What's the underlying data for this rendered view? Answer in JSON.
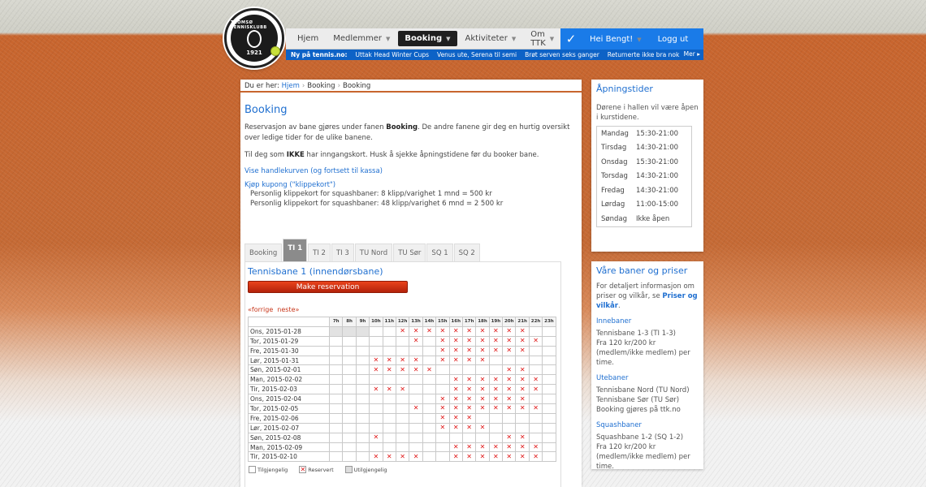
{
  "logo": {
    "name": "TROMSØ TENNISKLUBB",
    "year": "1921"
  },
  "nav": {
    "items": [
      {
        "label": "Hjem",
        "caret": false,
        "active": false
      },
      {
        "label": "Medlemmer",
        "caret": true,
        "active": false
      },
      {
        "label": "Booking",
        "caret": true,
        "active": true
      },
      {
        "label": "Aktiviteter",
        "caret": true,
        "active": false
      },
      {
        "label": "Om TTK",
        "caret": true,
        "active": false
      }
    ]
  },
  "user": {
    "greeting": "Hei Bengt!",
    "logout": "Logg ut",
    "check": "✓"
  },
  "ticker": {
    "label": "Ny på tennis.no:",
    "items": [
      "Uttak Head Winter Cups",
      "Venus ute, Serena til semi",
      "Brøt serven seks ganger",
      "Returnerte ikke bra nok"
    ],
    "more": "Mer ▸"
  },
  "breadcrumb": {
    "prefix": "Du er her:",
    "home": "Hjem",
    "level1": "Booking",
    "level2": "Booking"
  },
  "page": {
    "title": "Booking",
    "intro_pre": "Reservasjon av bane gjøres under fanen ",
    "intro_bold": "Booking",
    "intro_post": ". De andre fanene gir deg en hurtig oversikt over ledige tider for de ulike banene.",
    "card_pre": "Til deg som ",
    "card_bold": "IKKE",
    "card_post": " har inngangskort. Husk å sjekke åpningstidene før du booker bane.",
    "cart_link": "Vise handlekurven (og fortsett til kassa)",
    "coupon_link": "Kjøp kupong (\"klippekort\")",
    "coupon_1": "Personlig klippekort for squashbaner: 8 klipp/varighet 1 mnd = 500 kr",
    "coupon_2": "Personlig klippekort for squashbaner: 48 klipp/varighet 6 mnd = 2 500 kr"
  },
  "tabs": [
    "Booking",
    "TI 1",
    "TI 2",
    "TI 3",
    "TU Nord",
    "TU Sør",
    "SQ 1",
    "SQ 2"
  ],
  "active_tab": 1,
  "court": {
    "title": "Tennisbane 1 (innendørsbane)",
    "make_button": "Make reservation",
    "prev": "«forrige",
    "next": "neste»",
    "hours": [
      "7h",
      "8h",
      "9h",
      "10h",
      "11h",
      "12h",
      "13h",
      "14h",
      "15h",
      "16h",
      "17h",
      "18h",
      "19h",
      "20h",
      "21h",
      "22h",
      "23h"
    ],
    "rows": [
      {
        "date": "Ons, 2015-01-28",
        "cells": "UUU..XXXXXXXXXX.."
      },
      {
        "date": "Tor, 2015-01-29",
        "cells": "......X.XXXXXXXX."
      },
      {
        "date": "Fre, 2015-01-30",
        "cells": "........XXXXXXX.."
      },
      {
        "date": "Lør, 2015-01-31",
        "cells": "...XXXX.XXXX....."
      },
      {
        "date": "Søn, 2015-02-01",
        "cells": "...XXXXX.....XX.."
      },
      {
        "date": "Man, 2015-02-02",
        "cells": ".........XXXXXXX."
      },
      {
        "date": "Tir, 2015-02-03",
        "cells": "...XXX...XXXXXXX."
      },
      {
        "date": "Ons, 2015-02-04",
        "cells": "........XXXXXXX.."
      },
      {
        "date": "Tor, 2015-02-05",
        "cells": "......X.XXXXXXXX."
      },
      {
        "date": "Fre, 2015-02-06",
        "cells": "........XXX......"
      },
      {
        "date": "Lør, 2015-02-07",
        "cells": "........XXXX....."
      },
      {
        "date": "Søn, 2015-02-08",
        "cells": "...X.........XX.."
      },
      {
        "date": "Man, 2015-02-09",
        "cells": ".........XXXXXXX."
      },
      {
        "date": "Tir, 2015-02-10",
        "cells": "...XXXX..XXXXXXX."
      }
    ],
    "legend": {
      "available": "Tilgjengelig",
      "reserved": "Reservert",
      "unavailable": "Utilgjengelig"
    },
    "reserved_mark": "✕"
  },
  "opening": {
    "title": "Åpningstider",
    "text": "Dørene i hallen vil være åpen i kurstidene.",
    "rows": [
      {
        "day": "Mandag",
        "time": "15:30-21:00"
      },
      {
        "day": "Tirsdag",
        "time": "14:30-21:00"
      },
      {
        "day": "Onsdag",
        "time": "15:30-21:00"
      },
      {
        "day": "Torsdag",
        "time": "14:30-21:00"
      },
      {
        "day": "Fredag",
        "time": "14:30-21:00"
      },
      {
        "day": "Lørdag",
        "time": "11:00-15:00"
      },
      {
        "day": "Søndag",
        "time": "Ikke åpen"
      }
    ]
  },
  "prices": {
    "title": "Våre baner og priser",
    "intro_pre": "For detaljert informasjon om priser og vilkår, se ",
    "intro_link": "Priser og vilkår",
    "intro_post": ".",
    "sections": [
      {
        "heading": "Innebaner",
        "lines": [
          "Tennisbane 1-3 (TI 1-3)",
          "Fra 120 kr/200 kr (medlem/ikke medlem) per time."
        ]
      },
      {
        "heading": "Utebaner",
        "lines": [
          "Tennisbane Nord (TU Nord)",
          "Tennisbane Sør (TU Sør)",
          "Booking gjøres på ttk.no"
        ]
      },
      {
        "heading": "Squashbaner",
        "lines": [
          "Squashbane 1-2 (SQ 1-2)",
          "Fra 120 kr/200 kr (medlem/ikke medlem) per time."
        ]
      }
    ]
  }
}
